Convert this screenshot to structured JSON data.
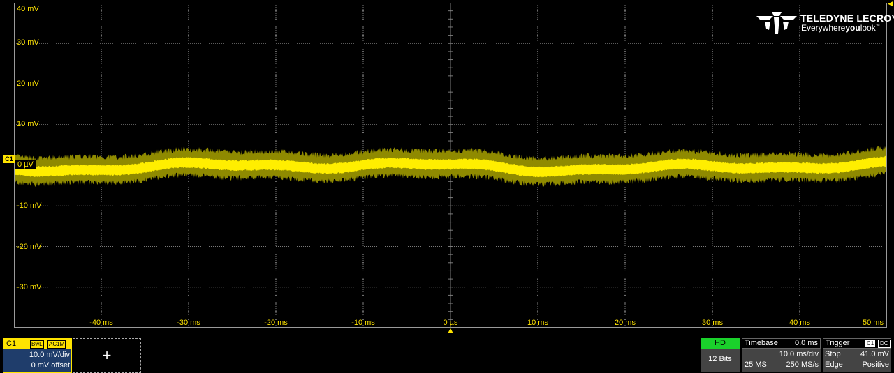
{
  "grid": {
    "y_labels": [
      "40 mV",
      "30 mV",
      "20 mV",
      "10 mV",
      "-10 mV",
      "-20 mV",
      "-30 mV"
    ],
    "zero_label": "0 µV",
    "x_labels": [
      "-40 ms",
      "-30 ms",
      "-20 ms",
      "-10 ms",
      "0 µs",
      "10 ms",
      "20 ms",
      "30 ms",
      "40 ms",
      "50 ms"
    ]
  },
  "channel_marker": "C1",
  "logo": {
    "name": "TELEDYNE LECROY",
    "tagline_pre": "Everywhere",
    "tagline_bold": "you",
    "tagline_post": "look",
    "tm": "™"
  },
  "channel": {
    "name": "C1",
    "badges": [
      "BwL",
      "AC1M"
    ],
    "volts_per_div": "10.0 mV/div",
    "offset": "0 mV offset"
  },
  "add_icon": "+",
  "hd": {
    "label": "HD",
    "bits": "12 Bits"
  },
  "timebase": {
    "title": "Timebase",
    "delay": "0.0 ms",
    "time_per_div": "10.0 ms/div",
    "samples": "25 MS",
    "sample_rate": "250 MS/s"
  },
  "trigger": {
    "title": "Trigger",
    "source": "C1",
    "coupling": "DC",
    "mode": "Stop",
    "level": "41.0 mV",
    "type": "Edge",
    "slope": "Positive"
  },
  "colors": {
    "trace": "#ffe400",
    "grid": "#7a7a7a",
    "hd_green": "#1ad12b",
    "channel_panel": "#1f3d6b"
  }
}
